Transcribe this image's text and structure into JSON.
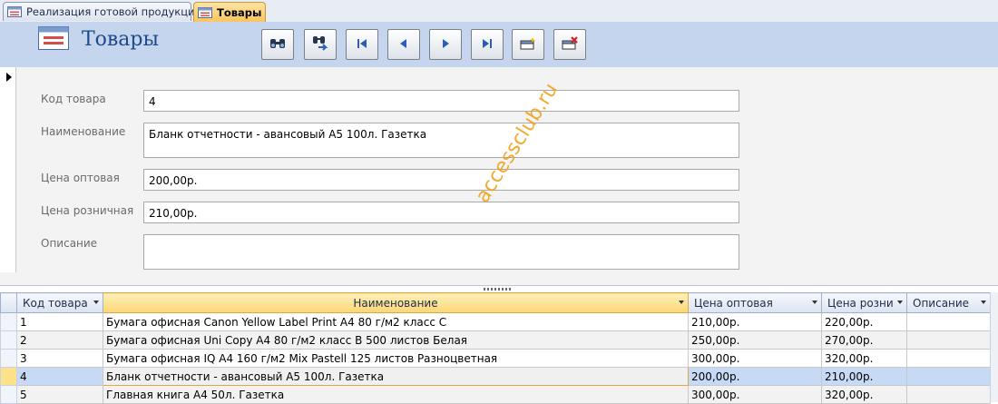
{
  "tabs": [
    {
      "label": "Реализация готовой продукции",
      "active": false
    },
    {
      "label": "Товары",
      "active": true
    }
  ],
  "form": {
    "title": "Товары",
    "toolbar_icons": [
      "find-icon",
      "find-next-icon",
      "first-record-icon",
      "previous-record-icon",
      "next-record-icon",
      "last-record-icon",
      "new-record-icon",
      "delete-record-icon"
    ]
  },
  "fields": {
    "code": {
      "label": "Код товара",
      "value": "4"
    },
    "name": {
      "label": "Наименование",
      "value": "Бланк отчетности - авансовый А5 100л. Газетка"
    },
    "wholesale": {
      "label": "Цена оптовая",
      "value": "200,00р."
    },
    "retail": {
      "label": "Цена розничная",
      "value": "210,00р."
    },
    "description": {
      "label": "Описание",
      "value": ""
    }
  },
  "watermark": "accessclub.ru",
  "datasheet": {
    "columns": [
      "Код товара",
      "Наименование",
      "Цена оптовая",
      "Цена розни",
      "Описание"
    ],
    "rows": [
      [
        "1",
        "Бумага офисная Canon Yellow Label Print А4 80 г/м2 класс С",
        "210,00р.",
        "220,00р.",
        ""
      ],
      [
        "2",
        "Бумага офисная Uni Copy А4 80 г/м2 класс В 500 листов Белая",
        "250,00р.",
        "270,00р.",
        ""
      ],
      [
        "3",
        "Бумага офисная IQ А4 160 г/м2 Mix Pastell 125 листов Разноцветная",
        "300,00р.",
        "320,00р.",
        ""
      ],
      [
        "4",
        "Бланк отчетности - авансовый А5 100л. Газетка",
        "200,00р.",
        "210,00р.",
        ""
      ],
      [
        "5",
        "Главная книга А4 50л. Газетка",
        "300,00р.",
        "320,00р.",
        ""
      ]
    ],
    "current_row": 3
  },
  "colors": {
    "header_band": "#c5d5ee",
    "active_tab": "#f9c55e",
    "title_text": "#1f4a8a",
    "selected_row": "#c6d9f5",
    "watermark": "#f0a21a"
  }
}
